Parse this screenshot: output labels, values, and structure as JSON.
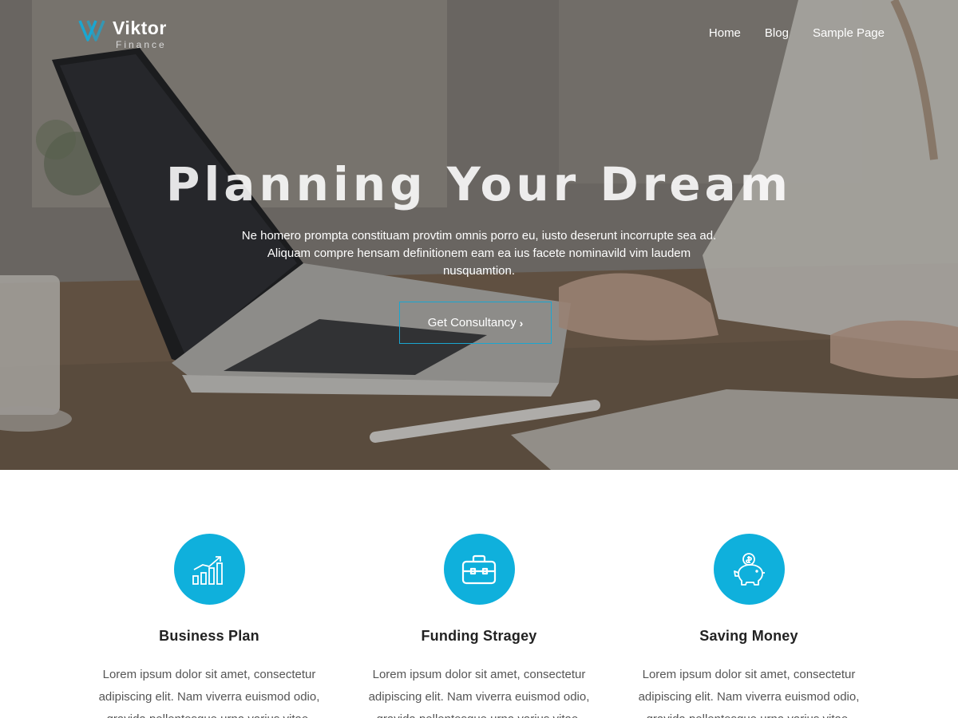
{
  "brand": {
    "name": "Viktor",
    "tagline": "Finance",
    "accent": "#0fb0dc"
  },
  "nav": {
    "items": [
      "Home",
      "Blog",
      "Sample Page"
    ]
  },
  "hero": {
    "title": "Planning Your Dream",
    "text": "Ne homero prompta constituam provtim omnis porro eu, iusto deserunt incorrupte sea ad. Aliquam compre hensam definitionem eam ea ius facete nominavild vim laudem nusquamtion.",
    "button_label": "Get Consultancy",
    "button_icon": "chevron-right-icon"
  },
  "features": [
    {
      "icon": "growth-chart-icon",
      "title": "Business Plan",
      "text": "Lorem ipsum dolor sit amet, consectetur adipiscing elit. Nam viverra euismod odio, gravida pellentesque urna varius vitae."
    },
    {
      "icon": "briefcase-icon",
      "title": "Funding Stragey",
      "text": "Lorem ipsum dolor sit amet, consectetur adipiscing elit. Nam viverra euismod odio, gravida pellentesque urna varius vitae."
    },
    {
      "icon": "piggy-bank-icon",
      "title": "Saving Money",
      "text": "Lorem ipsum dolor sit amet, consectetur adipiscing elit. Nam viverra euismod odio, gravida pellentesque urna varius vitae."
    }
  ]
}
